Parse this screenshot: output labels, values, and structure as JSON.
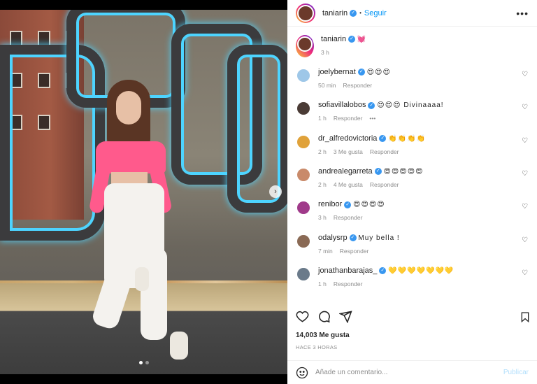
{
  "post": {
    "author": "taniarin",
    "follow_label": "Seguir",
    "more_label": "•••",
    "caption_emoji": "💓",
    "caption_time": "3 h",
    "likes": "14,003 Me gusta",
    "timestamp": "HACE 3 HORAS",
    "slide_indicator": "›"
  },
  "comments": [
    {
      "user": "joelybernat",
      "text": "😍😍😍",
      "time": "50 min",
      "likes": "",
      "reply": "Responder",
      "avatar_color": "#9ec7e8"
    },
    {
      "user": "sofiavillalobos",
      "text": "😍😍😍 Divinaaaa!",
      "time": "1 h",
      "likes": "",
      "reply": "Responder",
      "extra": "•••",
      "avatar_color": "#4a3b35"
    },
    {
      "user": "dr_alfredovictoria",
      "text": "👏👏👏👏",
      "time": "2 h",
      "likes": "3 Me gusta",
      "reply": "Responder",
      "avatar_color": "#e0a23a"
    },
    {
      "user": "andrealegarreta",
      "text": "😍😍😍😍😍",
      "time": "2 h",
      "likes": "4 Me gusta",
      "reply": "Responder",
      "avatar_color": "#c98a6a"
    },
    {
      "user": "renibor",
      "text": "😍😍😍😍",
      "time": "3 h",
      "likes": "",
      "reply": "Responder",
      "avatar_color": "#a03a8a"
    },
    {
      "user": "odalysrp",
      "text": "Muy bella !",
      "time": "7 min",
      "likes": "",
      "reply": "Responder",
      "avatar_color": "#8a6a55"
    },
    {
      "user": "jonathanbarajas_",
      "text": "💛💛💛💛💛💛💛",
      "time": "1 h",
      "likes": "",
      "reply": "Responder",
      "avatar_color": "#6a7a8a"
    }
  ],
  "comment_box": {
    "placeholder": "Añade un comentario...",
    "publish_label": "Publicar"
  },
  "colors": {
    "link_blue": "#0095f6",
    "verified_blue": "#3897f0",
    "muted_gray": "#8e8e8e"
  },
  "icons": [
    "heart-icon",
    "comment-icon",
    "share-icon",
    "bookmark-icon",
    "emoji-icon",
    "verified-icon",
    "more-icon",
    "next-slide-icon"
  ]
}
